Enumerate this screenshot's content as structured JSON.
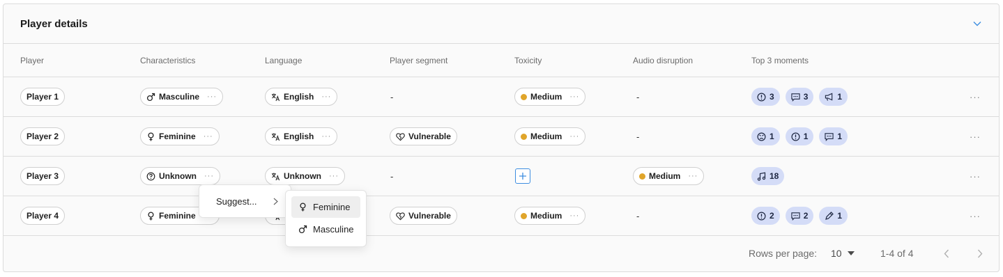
{
  "card": {
    "title": "Player details"
  },
  "columns": [
    "Player",
    "Characteristics",
    "Language",
    "Player segment",
    "Toxicity",
    "Audio disruption",
    "Top 3 moments"
  ],
  "colors": {
    "medium": "#e0a52a",
    "moment_bg": "#d4dcf7",
    "accent": "#3d8de0"
  },
  "rows": [
    {
      "player": "Player 1",
      "characteristic": {
        "icon": "male-icon",
        "label": "Masculine"
      },
      "language": {
        "icon": "translate-icon",
        "label": "English"
      },
      "segment": {
        "empty": "-"
      },
      "toxicity": {
        "label": "Medium"
      },
      "audio": {
        "empty": "-"
      },
      "moments": [
        {
          "icon": "alert-icon",
          "count": "3"
        },
        {
          "icon": "chat-icon",
          "count": "3"
        },
        {
          "icon": "megaphone-icon",
          "count": "1"
        }
      ]
    },
    {
      "player": "Player 2",
      "characteristic": {
        "icon": "female-icon",
        "label": "Feminine"
      },
      "language": {
        "icon": "translate-icon",
        "label": "English"
      },
      "segment": {
        "icon": "broken-heart-icon",
        "label": "Vulnerable"
      },
      "toxicity": {
        "label": "Medium"
      },
      "audio": {
        "empty": "-"
      },
      "moments": [
        {
          "icon": "angry-face-icon",
          "count": "1"
        },
        {
          "icon": "alert-icon",
          "count": "1"
        },
        {
          "icon": "chat-icon",
          "count": "1"
        }
      ]
    },
    {
      "player": "Player 3",
      "characteristic": {
        "icon": "question-icon",
        "label": "Unknown"
      },
      "language": {
        "icon": "translate-icon",
        "label": "Unknown"
      },
      "segment": {
        "empty": "-"
      },
      "toxicity": {
        "add": true
      },
      "audio": {
        "label": "Medium"
      },
      "moments": [
        {
          "icon": "music-icon",
          "count": "18"
        }
      ]
    },
    {
      "player": "Player 4",
      "characteristic": {
        "icon": "female-icon",
        "label": "Feminine"
      },
      "language": {
        "icon": "translate-icon",
        "label": ""
      },
      "segment": {
        "icon": "broken-heart-icon",
        "label": "Vulnerable"
      },
      "toxicity": {
        "label": "Medium"
      },
      "audio": {
        "empty": "-"
      },
      "moments": [
        {
          "icon": "alert-icon",
          "count": "2"
        },
        {
          "icon": "chat-icon",
          "count": "2"
        },
        {
          "icon": "pen-icon",
          "count": "1"
        }
      ]
    }
  ],
  "footer": {
    "rows_per_page_label": "Rows per page:",
    "rows_per_page_value": "10",
    "range": "1-4 of 4"
  },
  "context_menu": {
    "suggest": "Suggest..."
  },
  "submenu": {
    "items": [
      {
        "icon": "female-icon",
        "label": "Feminine",
        "selected": true
      },
      {
        "icon": "male-icon",
        "label": "Masculine",
        "selected": false
      }
    ]
  }
}
